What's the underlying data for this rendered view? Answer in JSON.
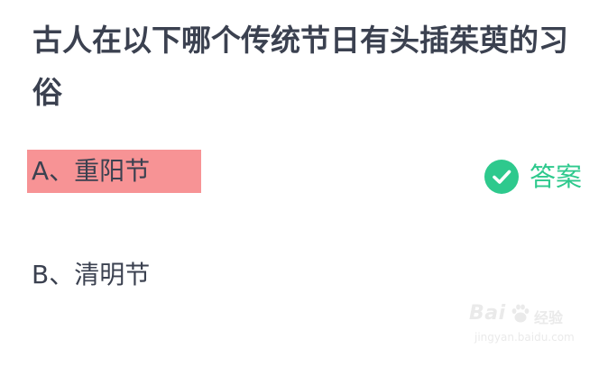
{
  "question": {
    "text": "古人在以下哪个传统节日有头插茱萸的习俗"
  },
  "options": [
    {
      "label": "A、重阳节",
      "highlighted": true,
      "highlight_color": "#f79395"
    },
    {
      "label": "B、清明节",
      "highlighted": false
    }
  ],
  "answer": {
    "icon": "check-circle-icon",
    "label": "答案",
    "color": "#2ec98d"
  },
  "watermark": {
    "brand": "Bai",
    "brand_suffix": "经验",
    "url": "jingyan.baidu.com"
  }
}
